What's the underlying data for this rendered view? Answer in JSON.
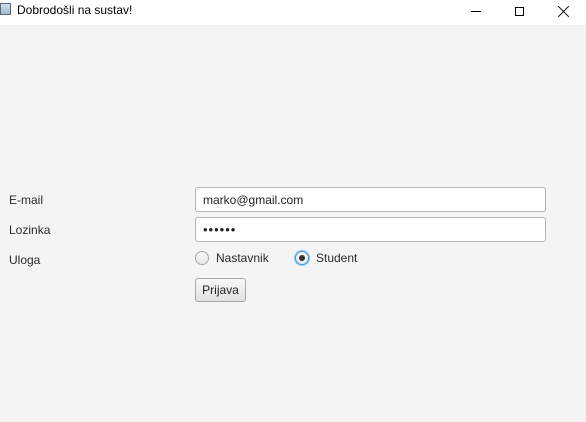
{
  "window": {
    "title": "Dobrodošli na sustav!",
    "icons": {
      "app": "app-window-icon",
      "minimize": "minimize-icon",
      "maximize": "maximize-icon",
      "close": "close-icon"
    }
  },
  "form": {
    "email_label": "E-mail",
    "email_value": "marko@gmail.com",
    "password_label": "Lozinka",
    "password_value": "••••••",
    "role_label": "Uloga",
    "role_options": [
      {
        "label": "Nastavnik",
        "selected": false
      },
      {
        "label": "Student",
        "selected": true
      }
    ],
    "submit_label": "Prijava"
  },
  "colors": {
    "background": "#f4f4f4",
    "focus_accent": "#3c9ad8"
  }
}
